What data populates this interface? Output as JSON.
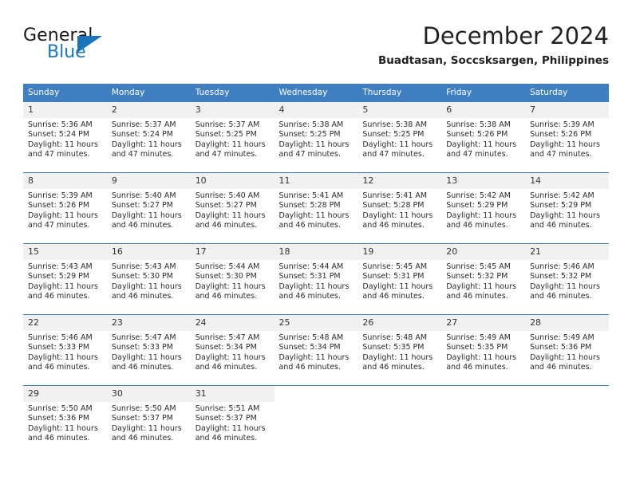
{
  "logo": {
    "text_primary": "General",
    "text_secondary": "Blue",
    "triangle_icon": "triangle-icon",
    "color_primary": "#1a1a1a",
    "color_secondary": "#1b75bb"
  },
  "header": {
    "title": "December 2024",
    "subtitle": "Buadtasan, Soccsksargen, Philippines"
  },
  "theme": {
    "header_bg": "#3f7ec1",
    "daynum_bg": "#f1f1f1",
    "cell_bg": "#ffffff",
    "text": "#2b2b2b"
  },
  "weekdays": [
    "Sunday",
    "Monday",
    "Tuesday",
    "Wednesday",
    "Thursday",
    "Friday",
    "Saturday"
  ],
  "weeks": [
    [
      {
        "day": "1",
        "sunrise": "Sunrise: 5:36 AM",
        "sunset": "Sunset: 5:24 PM",
        "daylight": "Daylight: 11 hours and 47 minutes."
      },
      {
        "day": "2",
        "sunrise": "Sunrise: 5:37 AM",
        "sunset": "Sunset: 5:24 PM",
        "daylight": "Daylight: 11 hours and 47 minutes."
      },
      {
        "day": "3",
        "sunrise": "Sunrise: 5:37 AM",
        "sunset": "Sunset: 5:25 PM",
        "daylight": "Daylight: 11 hours and 47 minutes."
      },
      {
        "day": "4",
        "sunrise": "Sunrise: 5:38 AM",
        "sunset": "Sunset: 5:25 PM",
        "daylight": "Daylight: 11 hours and 47 minutes."
      },
      {
        "day": "5",
        "sunrise": "Sunrise: 5:38 AM",
        "sunset": "Sunset: 5:25 PM",
        "daylight": "Daylight: 11 hours and 47 minutes."
      },
      {
        "day": "6",
        "sunrise": "Sunrise: 5:38 AM",
        "sunset": "Sunset: 5:26 PM",
        "daylight": "Daylight: 11 hours and 47 minutes."
      },
      {
        "day": "7",
        "sunrise": "Sunrise: 5:39 AM",
        "sunset": "Sunset: 5:26 PM",
        "daylight": "Daylight: 11 hours and 47 minutes."
      }
    ],
    [
      {
        "day": "8",
        "sunrise": "Sunrise: 5:39 AM",
        "sunset": "Sunset: 5:26 PM",
        "daylight": "Daylight: 11 hours and 47 minutes."
      },
      {
        "day": "9",
        "sunrise": "Sunrise: 5:40 AM",
        "sunset": "Sunset: 5:27 PM",
        "daylight": "Daylight: 11 hours and 46 minutes."
      },
      {
        "day": "10",
        "sunrise": "Sunrise: 5:40 AM",
        "sunset": "Sunset: 5:27 PM",
        "daylight": "Daylight: 11 hours and 46 minutes."
      },
      {
        "day": "11",
        "sunrise": "Sunrise: 5:41 AM",
        "sunset": "Sunset: 5:28 PM",
        "daylight": "Daylight: 11 hours and 46 minutes."
      },
      {
        "day": "12",
        "sunrise": "Sunrise: 5:41 AM",
        "sunset": "Sunset: 5:28 PM",
        "daylight": "Daylight: 11 hours and 46 minutes."
      },
      {
        "day": "13",
        "sunrise": "Sunrise: 5:42 AM",
        "sunset": "Sunset: 5:29 PM",
        "daylight": "Daylight: 11 hours and 46 minutes."
      },
      {
        "day": "14",
        "sunrise": "Sunrise: 5:42 AM",
        "sunset": "Sunset: 5:29 PM",
        "daylight": "Daylight: 11 hours and 46 minutes."
      }
    ],
    [
      {
        "day": "15",
        "sunrise": "Sunrise: 5:43 AM",
        "sunset": "Sunset: 5:29 PM",
        "daylight": "Daylight: 11 hours and 46 minutes."
      },
      {
        "day": "16",
        "sunrise": "Sunrise: 5:43 AM",
        "sunset": "Sunset: 5:30 PM",
        "daylight": "Daylight: 11 hours and 46 minutes."
      },
      {
        "day": "17",
        "sunrise": "Sunrise: 5:44 AM",
        "sunset": "Sunset: 5:30 PM",
        "daylight": "Daylight: 11 hours and 46 minutes."
      },
      {
        "day": "18",
        "sunrise": "Sunrise: 5:44 AM",
        "sunset": "Sunset: 5:31 PM",
        "daylight": "Daylight: 11 hours and 46 minutes."
      },
      {
        "day": "19",
        "sunrise": "Sunrise: 5:45 AM",
        "sunset": "Sunset: 5:31 PM",
        "daylight": "Daylight: 11 hours and 46 minutes."
      },
      {
        "day": "20",
        "sunrise": "Sunrise: 5:45 AM",
        "sunset": "Sunset: 5:32 PM",
        "daylight": "Daylight: 11 hours and 46 minutes."
      },
      {
        "day": "21",
        "sunrise": "Sunrise: 5:46 AM",
        "sunset": "Sunset: 5:32 PM",
        "daylight": "Daylight: 11 hours and 46 minutes."
      }
    ],
    [
      {
        "day": "22",
        "sunrise": "Sunrise: 5:46 AM",
        "sunset": "Sunset: 5:33 PM",
        "daylight": "Daylight: 11 hours and 46 minutes."
      },
      {
        "day": "23",
        "sunrise": "Sunrise: 5:47 AM",
        "sunset": "Sunset: 5:33 PM",
        "daylight": "Daylight: 11 hours and 46 minutes."
      },
      {
        "day": "24",
        "sunrise": "Sunrise: 5:47 AM",
        "sunset": "Sunset: 5:34 PM",
        "daylight": "Daylight: 11 hours and 46 minutes."
      },
      {
        "day": "25",
        "sunrise": "Sunrise: 5:48 AM",
        "sunset": "Sunset: 5:34 PM",
        "daylight": "Daylight: 11 hours and 46 minutes."
      },
      {
        "day": "26",
        "sunrise": "Sunrise: 5:48 AM",
        "sunset": "Sunset: 5:35 PM",
        "daylight": "Daylight: 11 hours and 46 minutes."
      },
      {
        "day": "27",
        "sunrise": "Sunrise: 5:49 AM",
        "sunset": "Sunset: 5:35 PM",
        "daylight": "Daylight: 11 hours and 46 minutes."
      },
      {
        "day": "28",
        "sunrise": "Sunrise: 5:49 AM",
        "sunset": "Sunset: 5:36 PM",
        "daylight": "Daylight: 11 hours and 46 minutes."
      }
    ],
    [
      {
        "day": "29",
        "sunrise": "Sunrise: 5:50 AM",
        "sunset": "Sunset: 5:36 PM",
        "daylight": "Daylight: 11 hours and 46 minutes."
      },
      {
        "day": "30",
        "sunrise": "Sunrise: 5:50 AM",
        "sunset": "Sunset: 5:37 PM",
        "daylight": "Daylight: 11 hours and 46 minutes."
      },
      {
        "day": "31",
        "sunrise": "Sunrise: 5:51 AM",
        "sunset": "Sunset: 5:37 PM",
        "daylight": "Daylight: 11 hours and 46 minutes."
      },
      {
        "day": "",
        "sunrise": "",
        "sunset": "",
        "daylight": ""
      },
      {
        "day": "",
        "sunrise": "",
        "sunset": "",
        "daylight": ""
      },
      {
        "day": "",
        "sunrise": "",
        "sunset": "",
        "daylight": ""
      },
      {
        "day": "",
        "sunrise": "",
        "sunset": "",
        "daylight": ""
      }
    ]
  ]
}
